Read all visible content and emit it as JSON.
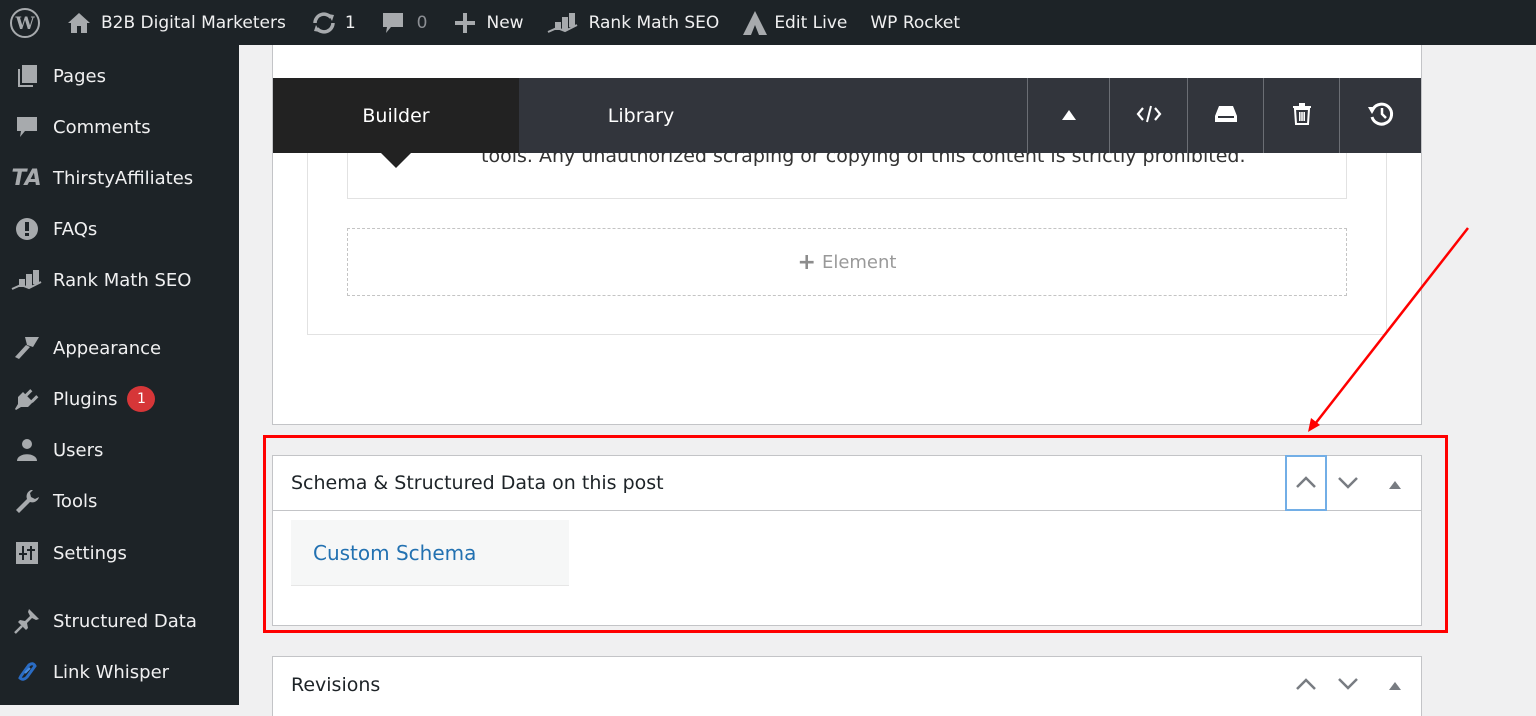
{
  "admin_bar": {
    "site_name": "B2B Digital Marketers",
    "updates_count": "1",
    "comments_count": "0",
    "new_label": "New",
    "rank_math_label": "Rank Math SEO",
    "edit_live_label": "Edit Live",
    "wp_rocket_label": "WP Rocket"
  },
  "sidebar": {
    "items": [
      {
        "label": "Pages",
        "icon": "pages-icon"
      },
      {
        "label": "Comments",
        "icon": "comments-icon"
      },
      {
        "label": "ThirstyAffiliates",
        "icon": "thirstyaffiliates-icon"
      },
      {
        "label": "FAQs",
        "icon": "faq-icon"
      },
      {
        "label": "Rank Math SEO",
        "icon": "rank-math-icon"
      },
      {
        "label": "Appearance",
        "icon": "paintbrush-icon"
      },
      {
        "label": "Plugins",
        "icon": "plugin-icon",
        "badge": "1"
      },
      {
        "label": "Users",
        "icon": "users-icon"
      },
      {
        "label": "Tools",
        "icon": "wrench-icon"
      },
      {
        "label": "Settings",
        "icon": "settings-icon"
      },
      {
        "label": "Structured Data",
        "icon": "pin-icon"
      },
      {
        "label": "Link Whisper",
        "icon": "link-whisper-icon"
      }
    ]
  },
  "builder": {
    "tabs": [
      {
        "label": "Builder",
        "active": true
      },
      {
        "label": "Library",
        "active": false
      }
    ],
    "tools": [
      "collapse-icon",
      "code-icon",
      "save-layout-icon",
      "trash-icon",
      "history-icon"
    ],
    "content_text": "tools. Any unauthorized scraping or copying of this content is strictly prohibited.",
    "add_element_label": "Element"
  },
  "schema_box": {
    "title": "Schema & Structured Data on this post",
    "tab_label": "Custom Schema"
  },
  "revisions_box": {
    "title": "Revisions"
  },
  "colors": {
    "admin_bg": "#1d2327",
    "link": "#2271b1",
    "badge": "#d63638",
    "annotation": "#ff0000"
  }
}
